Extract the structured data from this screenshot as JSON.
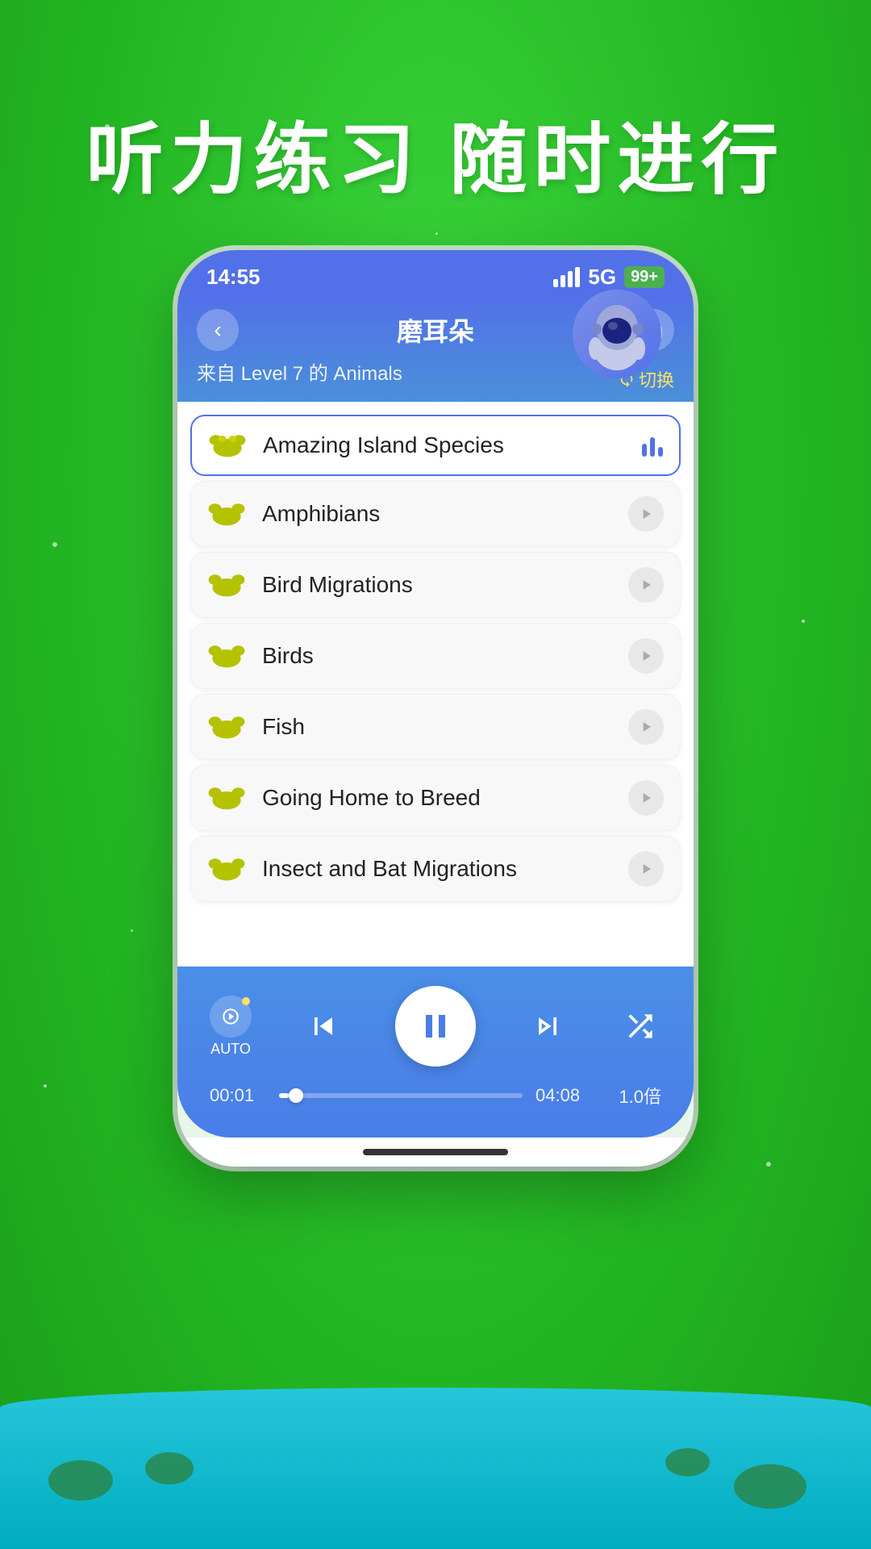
{
  "background": {
    "color": "#2ec72e"
  },
  "hero": {
    "text": "听力练习  随时进行"
  },
  "statusBar": {
    "time": "14:55",
    "signal": "5G",
    "battery": "99+"
  },
  "appHeader": {
    "title": "磨耳朵",
    "subtitle": "来自 Level 7 的 Animals",
    "switchLabel": "切换",
    "backLabel": "‹",
    "headphoneLabel": "🎧"
  },
  "tracks": [
    {
      "name": "Amazing Island Species",
      "active": true
    },
    {
      "name": "Amphibians",
      "active": false
    },
    {
      "name": "Bird Migrations",
      "active": false
    },
    {
      "name": "Birds",
      "active": false
    },
    {
      "name": "Fish",
      "active": false
    },
    {
      "name": "Going Home to Breed",
      "active": false
    },
    {
      "name": "Insect and Bat Migrations",
      "active": false
    }
  ],
  "player": {
    "autoLabel": "AUTO",
    "currentTime": "00:01",
    "totalTime": "04:08",
    "speed": "1.0倍",
    "progressPercent": 4
  }
}
